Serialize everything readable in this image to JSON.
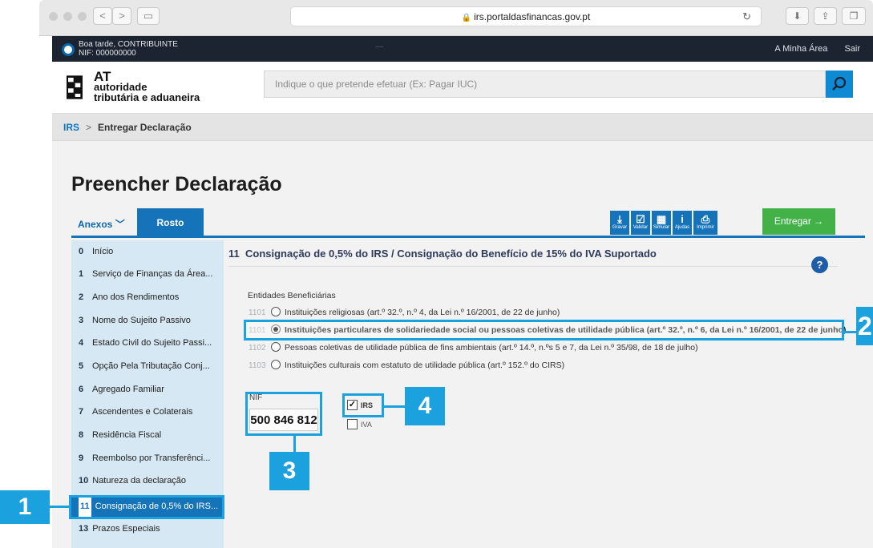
{
  "browser": {
    "url": "irs.portaldasfinancas.gov.pt",
    "back": "<",
    "forward": ">"
  },
  "topbar": {
    "greeting": "Boa tarde, CONTRIBUINTE",
    "nif": "NIF: 000000000",
    "dash": "—",
    "links": [
      "A Minha Área",
      "Sair"
    ]
  },
  "logo": {
    "line1": "AT",
    "line2": "autoridade",
    "line3": "tributária e aduaneira"
  },
  "search": {
    "placeholder": "Indique o que pretende efetuar (Ex: Pagar IUC)"
  },
  "breadcrumb": {
    "link": "IRS",
    "separator": ">",
    "current": "Entregar Declaração"
  },
  "page_title": "Preencher Declaração",
  "tabs": {
    "anexos": "Anexos",
    "rosto": "Rosto"
  },
  "toolbar": {
    "gravar": "Gravar",
    "validar": "Validar",
    "simular": "Simular",
    "ajudas": "Ajudas",
    "imprimir": "Imprimir",
    "entregar": "Entregar →"
  },
  "sidebar": {
    "items": [
      {
        "num": "0",
        "label": "Início"
      },
      {
        "num": "1",
        "label": "Serviço de Finanças da Área..."
      },
      {
        "num": "2",
        "label": "Ano dos Rendimentos"
      },
      {
        "num": "3",
        "label": "Nome do Sujeito Passivo"
      },
      {
        "num": "4",
        "label": "Estado Civil do Sujeito Passi..."
      },
      {
        "num": "5",
        "label": "Opção Pela Tributação Conj..."
      },
      {
        "num": "6",
        "label": "Agregado Familiar"
      },
      {
        "num": "7",
        "label": "Ascendentes e Colaterais"
      },
      {
        "num": "8",
        "label": "Residência Fiscal"
      },
      {
        "num": "9",
        "label": "Reembolso por Transferênci..."
      },
      {
        "num": "10",
        "label": "Natureza da declaração"
      },
      {
        "num": "11",
        "label": "Consignação de 0,5% do IRS..."
      },
      {
        "num": "13",
        "label": "Prazos Especiais"
      }
    ]
  },
  "section": {
    "number": "11",
    "title": "Consignação de 0,5% do IRS / Consignação do Benefício de 15% do IVA Suportado",
    "help": "?",
    "entities_label": "Entidades Beneficiárias",
    "options": [
      {
        "code": "1101",
        "label": "Instituições religiosas (art.º 32.º, n.º 4, da Lei n.º 16/2001, de 22 de junho)",
        "selected": false
      },
      {
        "code": "1101",
        "label": "Instituições particulares de solidariedade social ou pessoas coletivas de utilidade pública (art.º 32.º, n.º 6, da Lei n.º 16/2001, de 22 de junho)",
        "selected": true
      },
      {
        "code": "1102",
        "label": "Pessoas coletivas de utilidade pública de fins ambientais (art.º 14.º, n.ºs 5 e 7, da Lei n.º 35/98, de 18 de julho)",
        "selected": false
      },
      {
        "code": "1103",
        "label": "Instituições culturais com estatuto de utilidade pública (art.º 152.º do CIRS)",
        "selected": false
      }
    ],
    "nif_label": "NIF",
    "nif_value": "500 846 812",
    "checkboxes": [
      {
        "label": "IRS",
        "checked": true
      },
      {
        "label": "IVA",
        "checked": false
      }
    ]
  },
  "annotations": [
    "1",
    "2",
    "3",
    "4"
  ],
  "colors": {
    "primary": "#1574b9",
    "callout": "#1ca1df",
    "entregar": "#42b248",
    "topbar": "#1c2331"
  }
}
